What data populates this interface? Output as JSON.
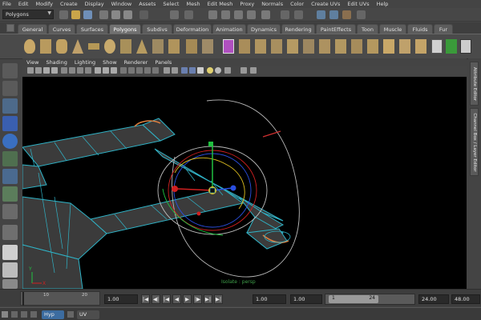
{
  "menubar": [
    "File",
    "Edit",
    "Modify",
    "Create",
    "Display",
    "Window",
    "Assets",
    "Select",
    "Mesh",
    "Edit Mesh",
    "Proxy",
    "Normals",
    "Color",
    "Create UVs",
    "Edit UVs",
    "Help"
  ],
  "status_line": {
    "mode": "Polygons"
  },
  "shelf_tabs": [
    {
      "label": "General",
      "active": false
    },
    {
      "label": "Curves",
      "active": false
    },
    {
      "label": "Surfaces",
      "active": false
    },
    {
      "label": "Polygons",
      "active": true
    },
    {
      "label": "Subdivs",
      "active": false
    },
    {
      "label": "Deformation",
      "active": false
    },
    {
      "label": "Animation",
      "active": false
    },
    {
      "label": "Dynamics",
      "active": false
    },
    {
      "label": "Rendering",
      "active": false
    },
    {
      "label": "PaintEffects",
      "active": false
    },
    {
      "label": "Toon",
      "active": false
    },
    {
      "label": "Muscle",
      "active": false
    },
    {
      "label": "Fluids",
      "active": false
    },
    {
      "label": "Fur",
      "active": false
    }
  ],
  "panel_menu": [
    "View",
    "Shading",
    "Lighting",
    "Show",
    "Renderer",
    "Panels"
  ],
  "viewport": {
    "camera_label": "Isolate : persp",
    "axis_labels": {
      "y": "Y",
      "x": "X"
    }
  },
  "side_tabs": [
    "Attribute Editor",
    "Channel Box / Layer Editor"
  ],
  "time_slider": {
    "ticks": [
      "10",
      "20"
    ],
    "current_frame": "1.00",
    "start_frame": "1.00",
    "playback_start": "1.00",
    "range_start": "1",
    "range_end": "24",
    "end_frame": "24.00",
    "anim_end": "48.00",
    "buttons": [
      "|◀",
      "◀|",
      "|◀",
      "◀",
      "▶",
      "|▶",
      "▶|",
      "▶|"
    ]
  },
  "taskbar": {
    "items": [
      "Hyp",
      "UV"
    ]
  },
  "colors": {
    "accent_tab": "#717171",
    "wire_cyan": "#2fb3c7",
    "manip_red": "#d02020",
    "manip_green": "#20c040",
    "manip_blue": "#2a4fe0",
    "manip_yellow": "#e0c020"
  }
}
